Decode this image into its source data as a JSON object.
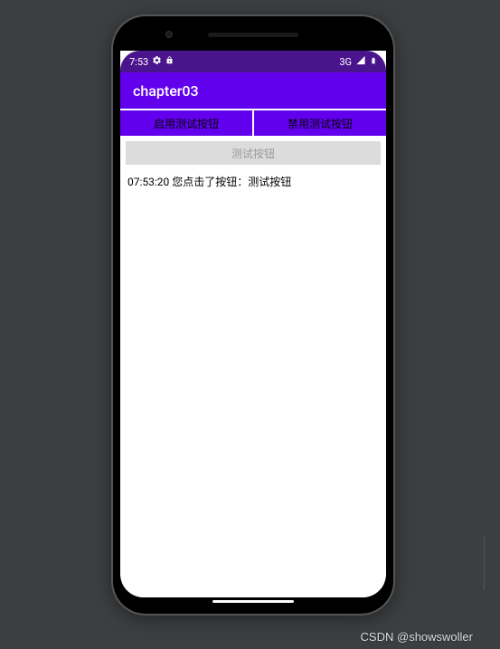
{
  "statusBar": {
    "time": "7:53",
    "networkLabel": "3G"
  },
  "appBar": {
    "title": "chapter03"
  },
  "buttons": {
    "enable": "启用测试按钮",
    "disable": "禁用测试按钮",
    "test": "测试按钮"
  },
  "log": {
    "message": "07:53:20 您点击了按钮：测试按钮"
  },
  "watermark": "CSDN @showswoller"
}
